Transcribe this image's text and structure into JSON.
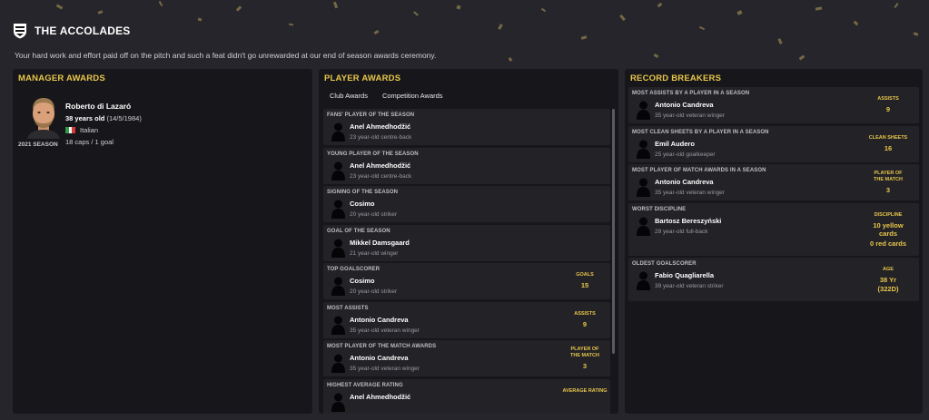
{
  "header": {
    "title": "THE ACCOLADES",
    "subtitle": "Your hard work and effort paid off on the pitch and such a feat didn't go unrewarded at our end of season awards ceremony."
  },
  "colors": {
    "accent": "#e9c64a",
    "background": "#25252b",
    "panel": "#17171b",
    "card": "#222227"
  },
  "manager_awards": {
    "title": "MANAGER AWARDS",
    "name": "Roberto di Lazaró",
    "age_bold": "38 years old",
    "age_rest": "(14/5/1984)",
    "nationality": "Italian",
    "caps": "18 caps / 1 goal",
    "season": "2021 SEASON"
  },
  "player_awards": {
    "title": "PLAYER AWARDS",
    "tabs": [
      {
        "label": "Club Awards",
        "active": true
      },
      {
        "label": "Competition Awards",
        "active": false
      }
    ],
    "items": [
      {
        "category": "FANS' PLAYER OF THE SEASON",
        "name": "Anel Ahmedhodžić",
        "desc": "23 year-old centre-back",
        "stat_label": "",
        "stat_value": ""
      },
      {
        "category": "YOUNG PLAYER OF THE SEASON",
        "name": "Anel Ahmedhodžić",
        "desc": "23 year-old centre-back",
        "stat_label": "",
        "stat_value": ""
      },
      {
        "category": "SIGNING OF THE SEASON",
        "name": "Cosimo",
        "desc": "20 year-old striker",
        "stat_label": "",
        "stat_value": ""
      },
      {
        "category": "GOAL OF THE SEASON",
        "name": "Mikkel Damsgaard",
        "desc": "21 year-old winger",
        "stat_label": "",
        "stat_value": ""
      },
      {
        "category": "TOP GOALSCORER",
        "name": "Cosimo",
        "desc": "20 year-old striker",
        "stat_label": "GOALS",
        "stat_value": "15"
      },
      {
        "category": "MOST ASSISTS",
        "name": "Antonio Candreva",
        "desc": "35 year-old veteran winger",
        "stat_label": "ASSISTS",
        "stat_value": "9"
      },
      {
        "category": "MOST PLAYER OF THE MATCH AWARDS",
        "name": "Antonio Candreva",
        "desc": "35 year-old veteran winger",
        "stat_label": "PLAYER OF THE MATCH",
        "stat_value": "3"
      },
      {
        "category": "HIGHEST AVERAGE RATING",
        "name": "Anel Ahmedhodžić",
        "desc": "",
        "stat_label": "AVERAGE RATING",
        "stat_value": ""
      }
    ]
  },
  "record_breakers": {
    "title": "RECORD BREAKERS",
    "items": [
      {
        "category": "MOST ASSISTS BY A PLAYER IN A SEASON",
        "name": "Antonio Candreva",
        "desc": "35 year-old veteran winger",
        "stat_label": "ASSISTS",
        "stat_value": "9"
      },
      {
        "category": "MOST CLEAN SHEETS BY A PLAYER IN A SEASON",
        "name": "Emil Audero",
        "desc": "25 year-old goalkeeper",
        "stat_label": "CLEAN SHEETS",
        "stat_value": "16"
      },
      {
        "category": "MOST PLAYER OF MATCH AWARDS IN A SEASON",
        "name": "Antonio Candreva",
        "desc": "35 year-old veteran winger",
        "stat_label": "PLAYER OF THE MATCH",
        "stat_value": "3"
      },
      {
        "category": "WORST DISCIPLINE",
        "name": "Bartosz Bereszyński",
        "desc": "29 year-old full-back",
        "stat_label": "DISCIPLINE",
        "stat_value": "10 yellow cards",
        "stat_value2": "0 red cards"
      },
      {
        "category": "OLDEST GOALSCORER",
        "name": "Fabio Quagliarella",
        "desc": "39 year-old veteran striker",
        "stat_label": "AGE",
        "stat_value": "38 Yr",
        "stat_value2": "(322D)"
      }
    ]
  }
}
